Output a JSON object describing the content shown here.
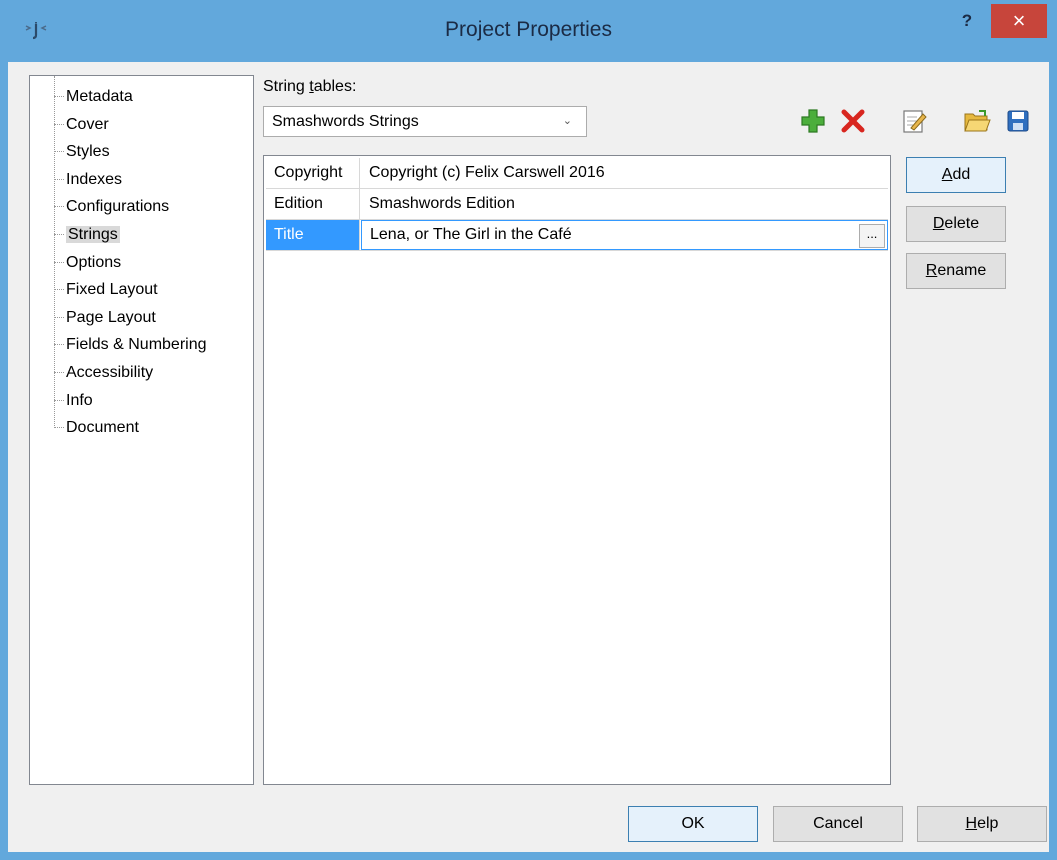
{
  "window": {
    "title": "Project Properties",
    "help_label": "?",
    "close_label": "×"
  },
  "tree": {
    "items": [
      {
        "label": "Metadata"
      },
      {
        "label": "Cover"
      },
      {
        "label": "Styles"
      },
      {
        "label": "Indexes"
      },
      {
        "label": "Configurations"
      },
      {
        "label": "Strings",
        "selected": true
      },
      {
        "label": "Options"
      },
      {
        "label": "Fixed Layout"
      },
      {
        "label": "Page Layout"
      },
      {
        "label": "Fields & Numbering"
      },
      {
        "label": "Accessibility"
      },
      {
        "label": "Info"
      },
      {
        "label": "Document"
      }
    ]
  },
  "string_tables": {
    "label_pre": "String ",
    "label_access": "t",
    "label_post": "ables:",
    "selected": "Smashwords Strings",
    "chevron": "⌄"
  },
  "toolbar": {
    "icons": [
      "add-table-icon",
      "delete-table-icon",
      "edit-table-icon",
      "open-folder-icon",
      "save-icon"
    ]
  },
  "grid": {
    "rows": [
      {
        "key": "Copyright",
        "value": "Copyright (c) Felix Carswell 2016"
      },
      {
        "key": "Edition",
        "value": "Smashwords Edition"
      },
      {
        "key": "Title",
        "value": "Lena, or The Girl in the Café",
        "selected": true
      }
    ],
    "ellipsis_label": "..."
  },
  "side_buttons": {
    "add_access": "A",
    "add_rest": "dd",
    "delete_access": "D",
    "delete_rest": "elete",
    "rename_access": "R",
    "rename_rest": "ename"
  },
  "footer": {
    "ok_label": "OK",
    "cancel_label": "Cancel",
    "help_access": "H",
    "help_rest": "elp"
  },
  "colors": {
    "titlebar": "#62a8dc",
    "close": "#c7453b",
    "selection": "#3399ff"
  }
}
